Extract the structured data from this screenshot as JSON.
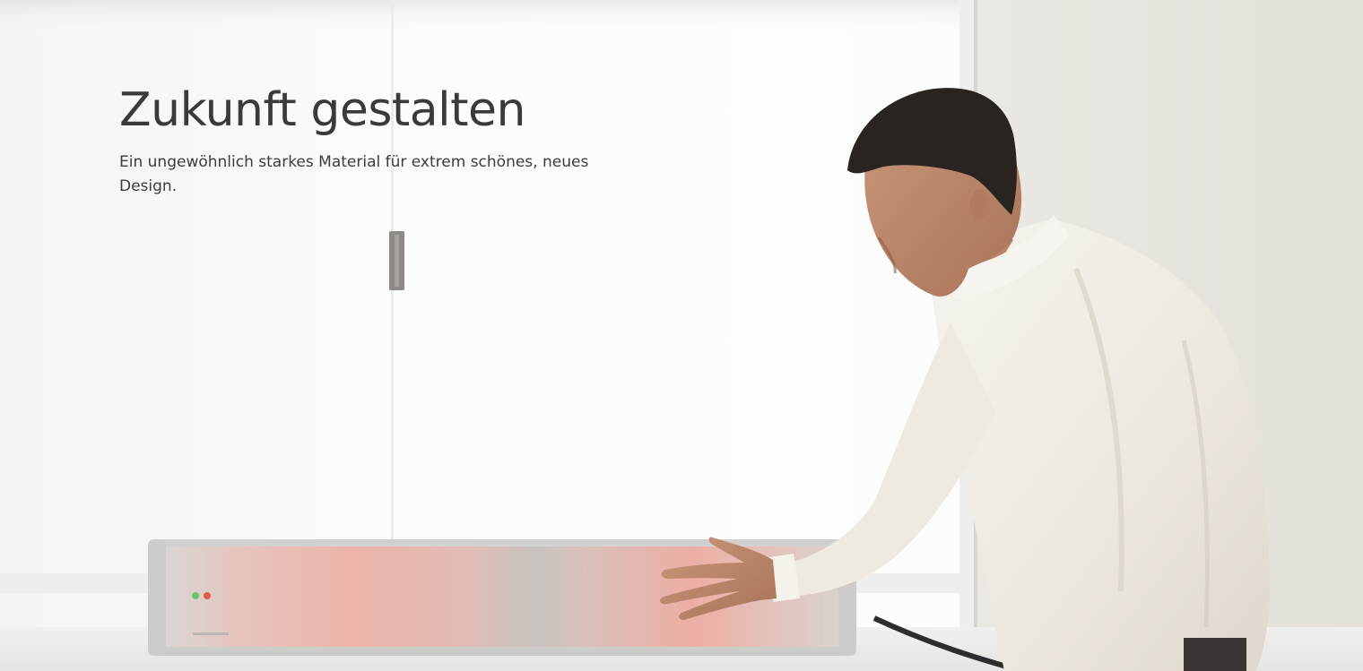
{
  "hero": {
    "title": "Zukunft gestalten",
    "subtitle": "Ein ungewöhnlich starkes Material für extrem schönes, neues Design."
  },
  "scene": {
    "subject": "man-presenting-heater-icon",
    "colors": {
      "background": "#f8f8f6",
      "wall": "#e9e6e1",
      "shirt": "#f3f0ea",
      "panel_glow": "#e8b7ad",
      "text": "#3a3a3a"
    }
  }
}
